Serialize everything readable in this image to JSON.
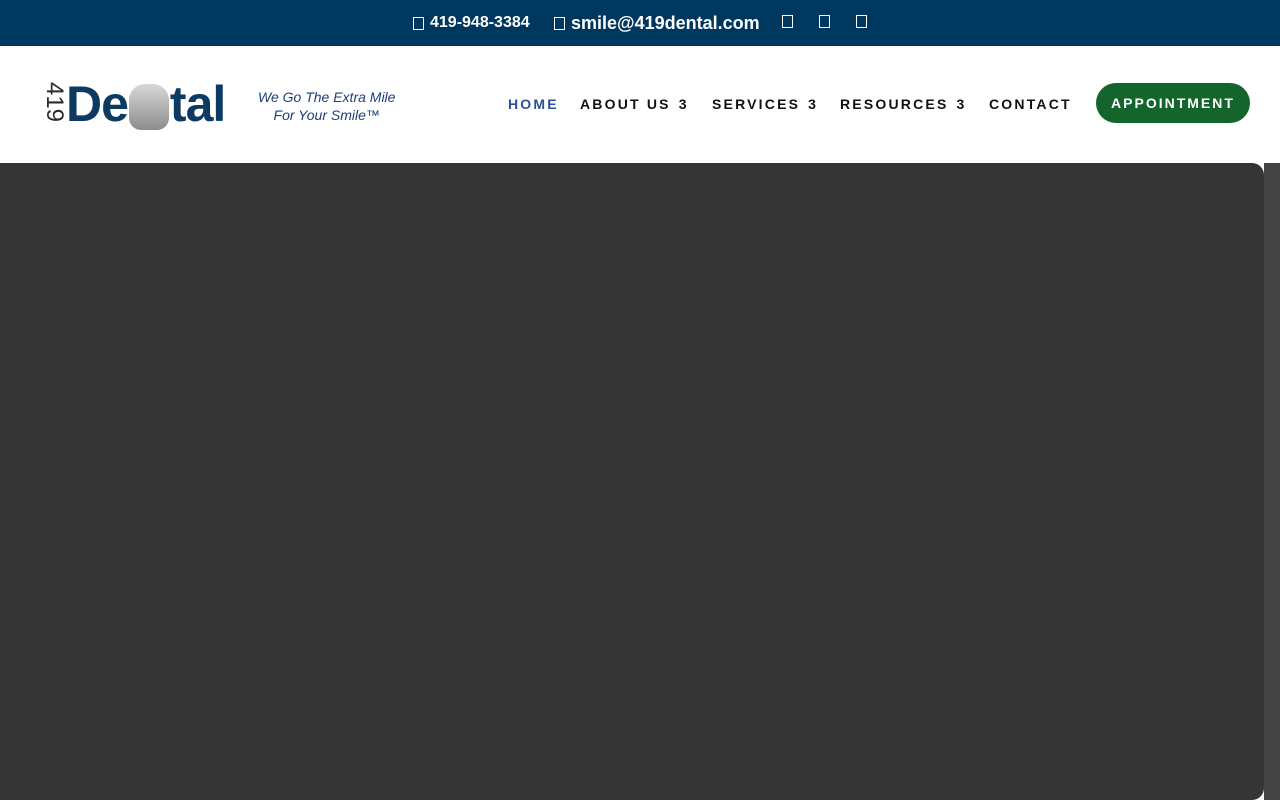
{
  "topbar": {
    "phone": "419-948-3384",
    "email": "smile@419dental.com",
    "phone_icon": "phone-icon",
    "email_icon": "email-icon",
    "social_icons": [
      "facebook-icon",
      "instagram-icon",
      "google-icon"
    ]
  },
  "logo": {
    "number": "419",
    "word_start": "De",
    "word_end": "tal",
    "tagline_line1": "We Go The Extra Mile",
    "tagline_line2": "For Your Smile™"
  },
  "nav": {
    "items": [
      {
        "label": "HOME",
        "active": true
      },
      {
        "label": "ABOUT US",
        "caret": "3"
      },
      {
        "label": "SERVICES",
        "caret": "3"
      },
      {
        "label": "RESOURCES",
        "caret": "3"
      },
      {
        "label": "CONTACT"
      }
    ],
    "appointment_label": "APPOINTMENT"
  },
  "colors": {
    "topbar_bg": "#00375f",
    "brand_navy": "#0d3a63",
    "active_nav": "#2c4f9e",
    "button_green": "#13652c",
    "hero_bg": "#353535"
  }
}
